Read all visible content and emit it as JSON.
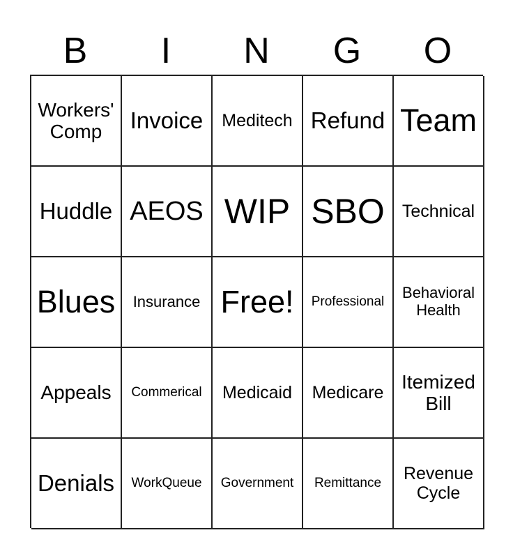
{
  "header": {
    "letters": [
      "B",
      "I",
      "N",
      "G",
      "O"
    ]
  },
  "board": {
    "rows": [
      [
        "Workers'\nComp",
        "Invoice",
        "Meditech",
        "Refund",
        "Team"
      ],
      [
        "Huddle",
        "AEOS",
        "WIP",
        "SBO",
        "Technical"
      ],
      [
        "Blues",
        "Insurance",
        "Free!",
        "Professional",
        "Behavioral\nHealth"
      ],
      [
        "Appeals",
        "Commerical",
        "Medicaid",
        "Medicare",
        "Itemized\nBill"
      ],
      [
        "Denials",
        "WorkQueue",
        "Government",
        "Remittance",
        "Revenue\nCycle"
      ]
    ]
  },
  "colors": {
    "text": "#000000",
    "grid_line": "#222222",
    "background": "#ffffff"
  }
}
